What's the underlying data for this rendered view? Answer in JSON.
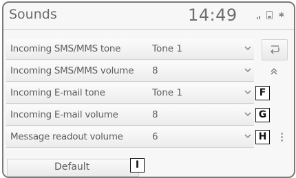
{
  "header": {
    "title": "Sounds",
    "clock": "14:49",
    "icons": [
      "signal-icon",
      "battery-icon",
      "bluetooth-icon"
    ]
  },
  "rows": [
    {
      "label": "Incoming SMS/MMS tone",
      "value": "Tone 1"
    },
    {
      "label": "Incoming SMS/MMS volume",
      "value": "8"
    },
    {
      "label": "Incoming E-mail tone",
      "value": "Tone 1"
    },
    {
      "label": "Incoming E-mail volume",
      "value": "8"
    },
    {
      "label": "Message readout volume",
      "value": "6"
    }
  ],
  "side_buttons": {
    "back_icon": "back-arrow-icon",
    "scroll_up_icon": "double-chevron-up-icon"
  },
  "callouts": [
    "F",
    "G",
    "H",
    "I"
  ],
  "default_button": {
    "label": "Default"
  },
  "colors": {
    "background": "#f7f7f7",
    "text": "#5e5e5e",
    "border": "#7a7a7a"
  }
}
